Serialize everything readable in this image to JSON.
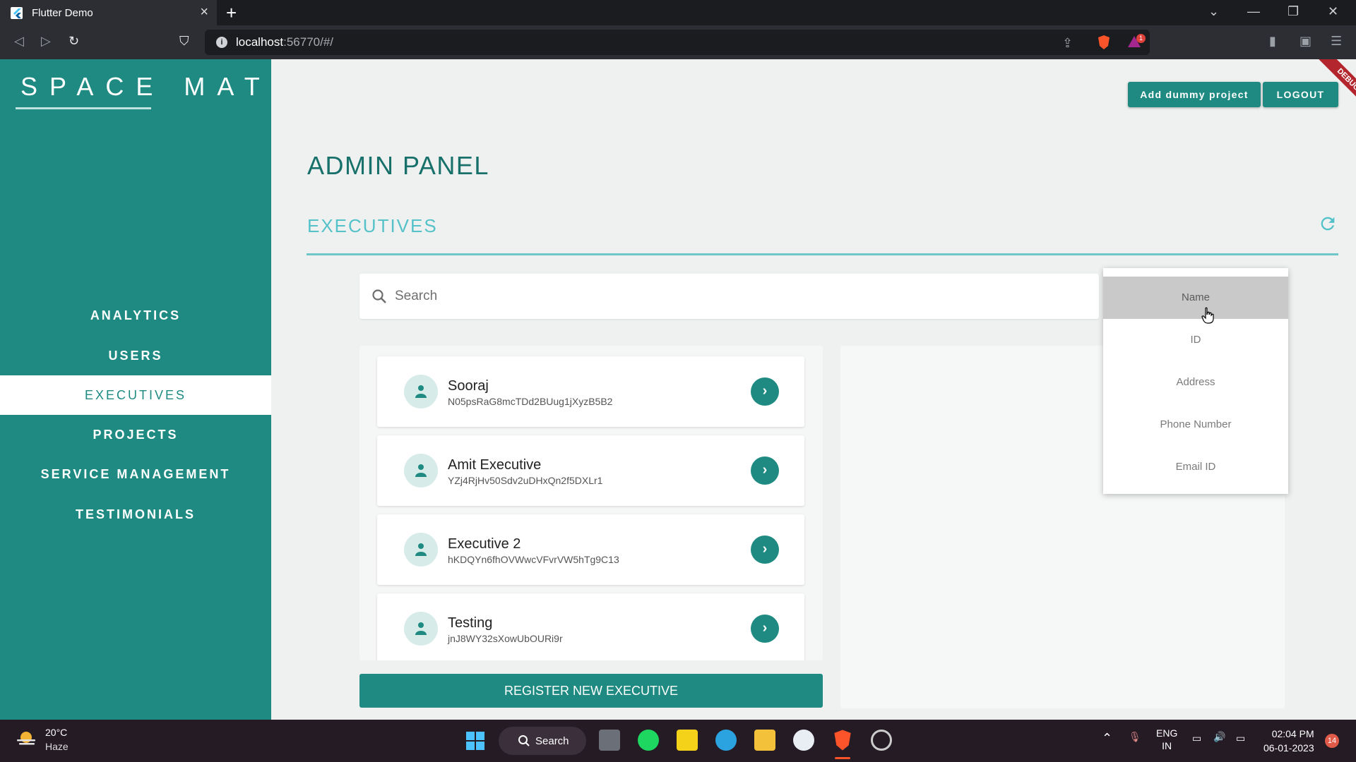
{
  "browser": {
    "tab_title": "Flutter Demo",
    "url_host": "localhost",
    "url_rest": ":56770/#/",
    "notification_count": "1"
  },
  "app": {
    "logo": "SPACE MATE",
    "header_buttons": {
      "add_dummy": "Add dummy project",
      "logout": "LOGOUT"
    },
    "debug_banner": "DEBUG",
    "page_title": "ADMIN PANEL",
    "section_title": "EXECUTIVES",
    "search_placeholder": "Search",
    "register_button": "REGISTER NEW EXECUTIVE"
  },
  "sidebar": {
    "items": [
      {
        "label": "ANALYTICS",
        "active": false
      },
      {
        "label": "USERS",
        "active": false
      },
      {
        "label": "EXECUTIVES",
        "active": true
      },
      {
        "label": "PROJECTS",
        "active": false
      },
      {
        "label": "SERVICE MANAGEMENT",
        "active": false
      },
      {
        "label": "TESTIMONIALS",
        "active": false
      }
    ]
  },
  "executives": [
    {
      "name": "Sooraj",
      "id": "N05psRaG8mcTDd2BUug1jXyzB5B2"
    },
    {
      "name": "Amit Executive",
      "id": "YZj4RjHv50Sdv2uDHxQn2f5DXLr1"
    },
    {
      "name": "Executive 2",
      "id": "hKDQYn6fhOVWwcVFvrVW5hTg9C13"
    },
    {
      "name": "Testing",
      "id": "jnJ8WY32sXowUbOURi9r"
    }
  ],
  "search_field_dropdown": {
    "options": [
      "Name",
      "ID",
      "Address",
      "Phone Number",
      "Email ID"
    ],
    "highlighted": "Name"
  },
  "taskbar": {
    "temperature": "20°C",
    "condition": "Haze",
    "search_label": "Search",
    "lang": "ENG",
    "region": "IN",
    "time": "02:04 PM",
    "date": "06-01-2023",
    "notifications": "14"
  },
  "colors": {
    "primary": "#1e8a82",
    "accent": "#55c2c9",
    "sidebar_text": "#ffffff"
  }
}
